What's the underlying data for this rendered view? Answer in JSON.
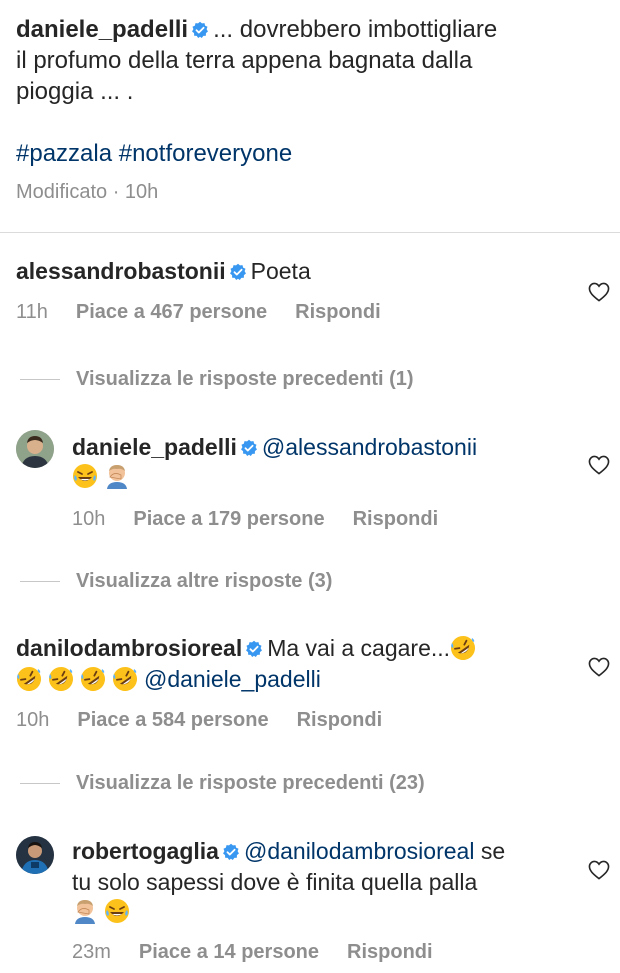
{
  "post": {
    "username": "daniele_padelli",
    "caption_line1": "... dovrebbero imbottigliare",
    "caption_line2": "il profumo della terra appena bagnata dalla",
    "caption_line3": "pioggia ... .",
    "hashtags": "#pazzala #notforeveryone",
    "edited": "Modificato · 10h"
  },
  "comments": [
    {
      "username": "alessandrobastonii",
      "text": "Poeta",
      "time": "11h",
      "likes": "Piace a 467 persone",
      "reply": "Rispondi"
    },
    {
      "username": "daniele_padelli",
      "mention": "@alessandrobastonii",
      "time": "10h",
      "likes": "Piace a 179 persone",
      "reply": "Rispondi"
    },
    {
      "username": "danilodambrosioreal",
      "text": "Ma vai a cagare...",
      "mention": "@daniele_padelli",
      "time": "10h",
      "likes": "Piace a 584 persone",
      "reply": "Rispondi"
    },
    {
      "username": "robertogaglia",
      "mention": "@danilodambrosioreal",
      "text_after_mention": " se",
      "text_line2": "tu solo sapessi dove è finita quella palla",
      "time": "23m",
      "likes": "Piace a 14 persone",
      "reply": "Rispondi"
    }
  ],
  "thread_links": {
    "previous_1": "Visualizza le risposte precedenti (1)",
    "others_3": "Visualizza altre risposte (3)",
    "previous_23": "Visualizza le risposte precedenti (23)"
  },
  "colors": {
    "text": "#262626",
    "meta": "#8e8e8e",
    "verified": "#3897f0",
    "hashtag": "#003569"
  }
}
